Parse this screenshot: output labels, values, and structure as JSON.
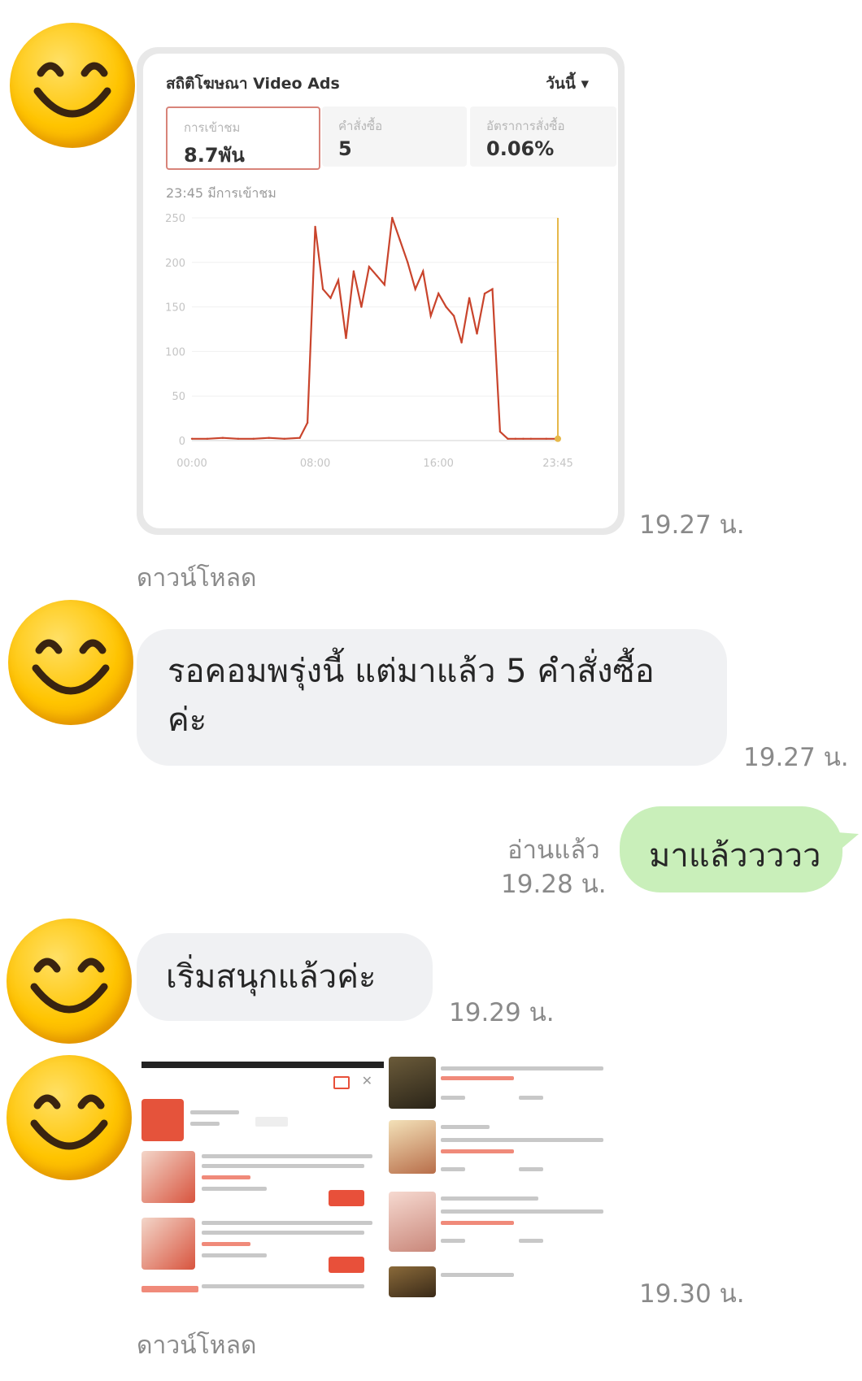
{
  "messages": {
    "m1": {
      "time": "19.27 น.",
      "download": "ดาวน์โหลด"
    },
    "m2": {
      "text": "รอคอมพรุ่งนี้ แต่มาแล้ว 5 คำสั่งซื้อค่ะ",
      "time": "19.27 น."
    },
    "m3": {
      "text": "มาแล้ววววว",
      "read": "อ่านแล้ว",
      "time": "19.28 น."
    },
    "m4": {
      "text": "เริ่มสนุกแล้วค่ะ",
      "time": "19.29 น."
    },
    "m5": {
      "time": "19.30 น.",
      "download": "ดาวน์โหลด"
    }
  },
  "stats_card": {
    "title": "สถิติโฆษณา Video Ads",
    "period": "วันนี้ ▾",
    "kpis": [
      {
        "label": "การเข้าชม",
        "value": "8.7พัน"
      },
      {
        "label": "คำสั่งซื้อ",
        "value": "5"
      },
      {
        "label": "อัตราการสั่งซื้อ",
        "value": "0.06%"
      }
    ],
    "timestamp": "23:45 มีการเข้าชม",
    "line_color": "#c9442c",
    "chart_data": {
      "type": "line",
      "y_ticks": [
        "250",
        "200",
        "150",
        "100",
        "50",
        "0"
      ],
      "x_ticks": [
        "00:00",
        "08:00",
        "16:00",
        "23:45"
      ],
      "ylim": [
        0,
        250
      ],
      "x": [
        "00:00",
        "01:00",
        "02:00",
        "03:00",
        "04:00",
        "05:00",
        "06:00",
        "07:00",
        "07:30",
        "08:00",
        "08:30",
        "09:00",
        "09:30",
        "10:00",
        "10:30",
        "11:00",
        "11:30",
        "12:00",
        "12:30",
        "13:00",
        "13:30",
        "14:00",
        "14:30",
        "15:00",
        "15:30",
        "16:00",
        "16:30",
        "17:00",
        "17:30",
        "18:00",
        "18:30",
        "19:00",
        "19:30",
        "20:00",
        "20:30",
        "21:00",
        "21:30",
        "22:00",
        "23:00",
        "23:45"
      ],
      "values": [
        2,
        2,
        3,
        2,
        2,
        3,
        2,
        3,
        20,
        240,
        170,
        160,
        180,
        115,
        190,
        150,
        195,
        185,
        175,
        250,
        225,
        200,
        170,
        190,
        140,
        165,
        150,
        140,
        110,
        160,
        120,
        165,
        170,
        10,
        2,
        2,
        2,
        2,
        2,
        2
      ]
    }
  }
}
